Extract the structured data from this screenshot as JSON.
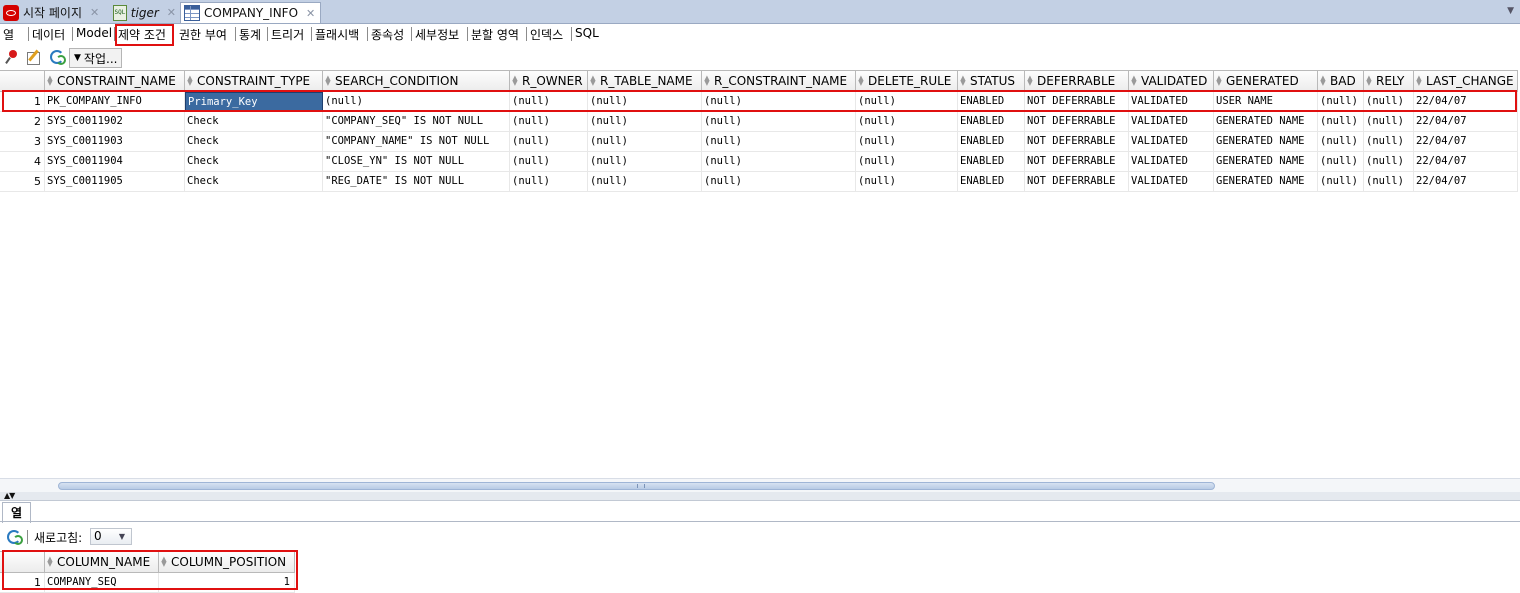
{
  "doc_tabs": [
    {
      "label": "시작 페이지",
      "icon": "oracle-icon"
    },
    {
      "label": "tiger",
      "icon": "sql-worksheet-icon"
    },
    {
      "label": "COMPANY_INFO",
      "icon": "table-icon"
    }
  ],
  "sub_tabs": [
    "열",
    "데이터",
    "Model",
    "제약 조건",
    "권한 부여",
    "통계",
    "트리거",
    "플래시백",
    "종속성",
    "세부정보",
    "분할 영역",
    "인덱스",
    "SQL"
  ],
  "active_sub_tab": "제약 조건",
  "toolbar": {
    "actions_label": "작업..."
  },
  "constraints": {
    "columns": [
      "CONSTRAINT_NAME",
      "CONSTRAINT_TYPE",
      "SEARCH_CONDITION",
      "R_OWNER",
      "R_TABLE_NAME",
      "R_CONSTRAINT_NAME",
      "DELETE_RULE",
      "STATUS",
      "DEFERRABLE",
      "VALIDATED",
      "GENERATED",
      "BAD",
      "RELY",
      "LAST_CHANGE"
    ],
    "rows": [
      {
        "num": "1",
        "cells": [
          "PK_COMPANY_INFO",
          "Primary_Key",
          "(null)",
          "(null)",
          "(null)",
          "(null)",
          "(null)",
          "ENABLED",
          "NOT DEFERRABLE",
          "VALIDATED",
          "USER NAME",
          "(null)",
          "(null)",
          "22/04/07"
        ]
      },
      {
        "num": "2",
        "cells": [
          "SYS_C0011902",
          "Check",
          "\"COMPANY_SEQ\" IS NOT NULL",
          "(null)",
          "(null)",
          "(null)",
          "(null)",
          "ENABLED",
          "NOT DEFERRABLE",
          "VALIDATED",
          "GENERATED NAME",
          "(null)",
          "(null)",
          "22/04/07"
        ]
      },
      {
        "num": "3",
        "cells": [
          "SYS_C0011903",
          "Check",
          "\"COMPANY_NAME\" IS NOT NULL",
          "(null)",
          "(null)",
          "(null)",
          "(null)",
          "ENABLED",
          "NOT DEFERRABLE",
          "VALIDATED",
          "GENERATED NAME",
          "(null)",
          "(null)",
          "22/04/07"
        ]
      },
      {
        "num": "4",
        "cells": [
          "SYS_C0011904",
          "Check",
          "\"CLOSE_YN\" IS NOT NULL",
          "(null)",
          "(null)",
          "(null)",
          "(null)",
          "ENABLED",
          "NOT DEFERRABLE",
          "VALIDATED",
          "GENERATED NAME",
          "(null)",
          "(null)",
          "22/04/07"
        ]
      },
      {
        "num": "5",
        "cells": [
          "SYS_C0011905",
          "Check",
          "\"REG_DATE\" IS NOT NULL",
          "(null)",
          "(null)",
          "(null)",
          "(null)",
          "ENABLED",
          "NOT DEFERRABLE",
          "VALIDATED",
          "GENERATED NAME",
          "(null)",
          "(null)",
          "22/04/07"
        ]
      }
    ],
    "selected_row": 0,
    "selected_col": 1
  },
  "bottom_panel": {
    "tab_label": "열",
    "refresh_label": "새로고침:",
    "refresh_value": "0",
    "columns": [
      "COLUMN_NAME",
      "COLUMN_POSITION"
    ],
    "rows": [
      {
        "num": "1",
        "cells": [
          "COMPANY_SEQ",
          "1"
        ]
      }
    ]
  },
  "colors": {
    "highlight": "#e01010",
    "selection": "#3b6aa0",
    "tabbar": "#c3d0e4"
  }
}
